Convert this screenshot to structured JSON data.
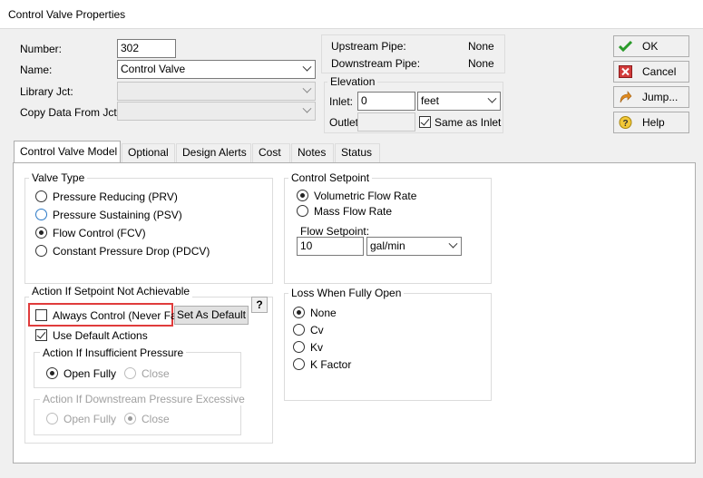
{
  "window": {
    "title": "Control Valve Properties"
  },
  "form": {
    "number_label": "Number:",
    "number_value": "302",
    "name_label": "Name:",
    "name_value": "Control Valve",
    "library_label": "Library Jct:",
    "library_value": "",
    "copy_label": "Copy Data From Jct...",
    "copy_value": ""
  },
  "pipes": {
    "upstream_label": "Upstream Pipe:",
    "upstream_value": "None",
    "downstream_label": "Downstream Pipe:",
    "downstream_value": "None"
  },
  "elevation": {
    "title": "Elevation",
    "inlet_label": "Inlet:",
    "inlet_value": "0",
    "unit": "feet",
    "outlet_label": "Outlet:",
    "outlet_value": "",
    "same_as_inlet_label": "Same as Inlet",
    "same_as_inlet_checked": true
  },
  "buttons": {
    "ok": "OK",
    "cancel": "Cancel",
    "jump": "Jump...",
    "help": "Help"
  },
  "tabs": [
    {
      "label": "Control Valve Model",
      "active": true
    },
    {
      "label": "Optional"
    },
    {
      "label": "Design Alerts"
    },
    {
      "label": "Cost"
    },
    {
      "label": "Notes"
    },
    {
      "label": "Status"
    }
  ],
  "valve_type": {
    "title": "Valve Type",
    "options": [
      "Pressure Reducing (PRV)",
      "Pressure Sustaining (PSV)",
      "Flow Control (FCV)",
      "Constant Pressure Drop (PDCV)"
    ],
    "selected": "Flow Control (FCV)"
  },
  "control_setpoint": {
    "title": "Control Setpoint",
    "options": [
      "Volumetric Flow Rate",
      "Mass Flow Rate"
    ],
    "selected": "Volumetric Flow Rate",
    "flow_setpoint_label": "Flow Setpoint:",
    "flow_setpoint_value": "10",
    "flow_unit": "gal/min"
  },
  "action_setpoint": {
    "title": "Action If Setpoint Not Achievable",
    "always_control_label": "Always Control (Never Fail)",
    "always_control_checked": false,
    "set_default_label": "Set As Default",
    "help_label": "?",
    "use_default_label": "Use Default Actions",
    "use_default_checked": true,
    "insufficient": {
      "title": "Action If Insufficient Pressure",
      "open_fully": "Open Fully",
      "close": "Close",
      "selected": "Open Fully"
    },
    "excessive": {
      "title": "Action If Downstream Pressure Excessive",
      "open_fully": "Open Fully",
      "close": "Close",
      "selected": "Close"
    }
  },
  "loss_open": {
    "title": "Loss When Fully Open",
    "options": [
      "None",
      "Cv",
      "Kv",
      "K Factor"
    ],
    "selected": "None"
  },
  "colors": {
    "highlight_box": "#e03c3c",
    "accent": "#2b79c6"
  }
}
